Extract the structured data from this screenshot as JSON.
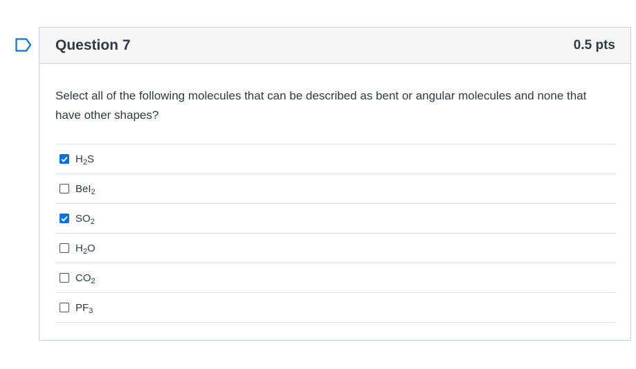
{
  "question": {
    "title": "Question 7",
    "points": "0.5 pts",
    "text": "Select all of the following molecules that can be described as bent or angular molecules and none that have other shapes?"
  },
  "answers": [
    {
      "base": "H",
      "sub": "2",
      "rest": "S",
      "checked": true
    },
    {
      "base": "BeI",
      "sub": "2",
      "rest": "",
      "checked": false
    },
    {
      "base": "SO",
      "sub": "2",
      "rest": "",
      "checked": true
    },
    {
      "base": "H",
      "sub": "2",
      "rest": "O",
      "checked": false
    },
    {
      "base": "CO",
      "sub": "2",
      "rest": "",
      "checked": false
    },
    {
      "base": "PF",
      "sub": "3",
      "rest": "",
      "checked": false
    }
  ],
  "colors": {
    "accent": "#0770e3",
    "flag": "#0770e3"
  },
  "icons": {
    "flag": "bookmark-flag-icon",
    "check": "checkmark-icon"
  }
}
